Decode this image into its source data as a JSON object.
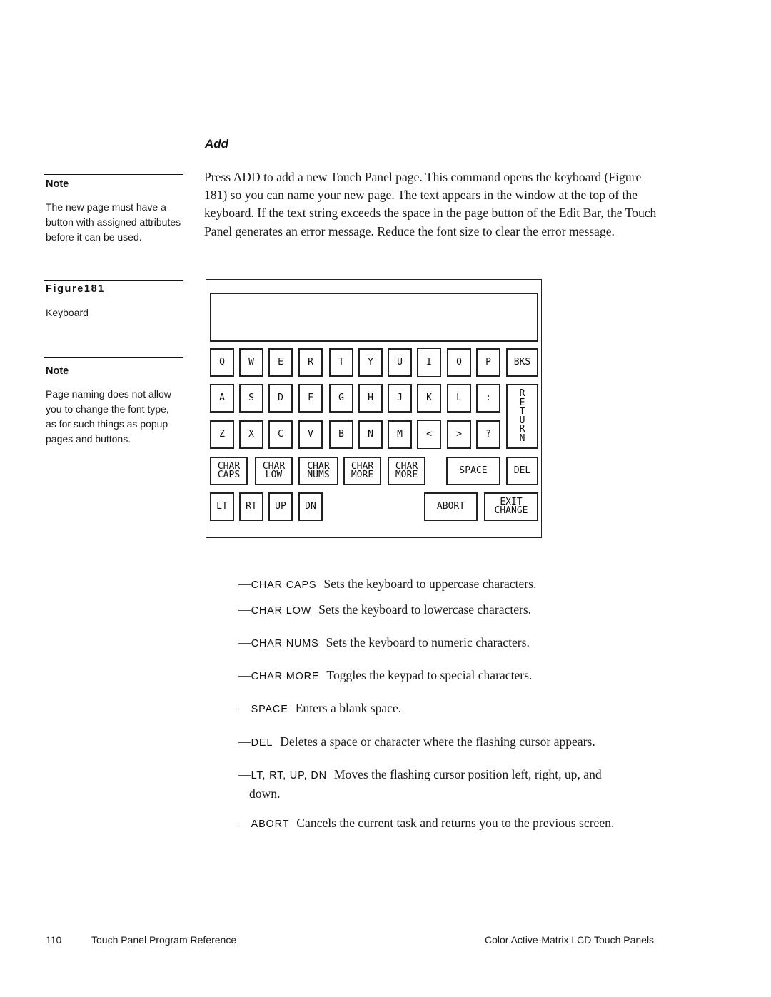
{
  "sidebar": {
    "note1": {
      "heading": "Note",
      "text": "The new page must have a button with assigned attributes before it can be used."
    },
    "figure": {
      "label": "Figure181",
      "caption": "Keyboard"
    },
    "note2": {
      "heading": "Note",
      "text": "Page naming does not allow you to change the font type, as for such things as popup pages and buttons."
    }
  },
  "main": {
    "section_title": "Add",
    "paragraph": "Press ADD to add a new Touch Panel page. This command opens the keyboard (Figure 181) so you can name your new page. The text appears in the window at the top of the keyboard. If the text string exceeds the space in the page button of the Edit Bar, the Touch Panel generates an error message. Reduce the font size to clear the error message."
  },
  "keyboard": {
    "display_text": "",
    "row1": [
      "Q",
      "W",
      "E",
      "R",
      "T",
      "Y",
      "U",
      "I",
      "O",
      "P",
      "BKS"
    ],
    "row2": [
      "A",
      "S",
      "D",
      "F",
      "G",
      "H",
      "J",
      "K",
      "L",
      ":"
    ],
    "row3": [
      "Z",
      "X",
      "C",
      "V",
      "B",
      "N",
      "M",
      "<",
      ">",
      "?"
    ],
    "return_key": "R\nE\nT\nU\nR\nN",
    "row4": [
      "CHAR\nCAPS",
      "CHAR\nLOW",
      "CHAR\nNUMS",
      "CHAR\nMORE",
      "CHAR\nMORE",
      "SPACE",
      "DEL"
    ],
    "row5": [
      "LT",
      "RT",
      "UP",
      "DN",
      "ABORT",
      "EXIT\nCHANGE"
    ]
  },
  "descriptions": [
    {
      "dash": "—",
      "term": "CHAR CAPS",
      "text": "Sets the keyboard to uppercase characters."
    },
    {
      "dash": "—",
      "term": "CHAR LOW",
      "text": "Sets the keyboard to lowercase characters."
    },
    {
      "dash": "—",
      "term": "CHAR NUMS",
      "text": "Sets the keyboard to numeric characters."
    },
    {
      "dash": "—",
      "term": "CHAR MORE",
      "text": "Toggles the keypad to special characters."
    },
    {
      "dash": "—",
      "term": "SPACE",
      "text": "Enters a blank space."
    },
    {
      "dash": "—",
      "term": "DEL",
      "text": "Deletes a space or character where the flashing cursor appears."
    },
    {
      "dash": "—",
      "term": "LT, RT, UP, DN",
      "text": "Moves the flashing cursor position left, right, up, and",
      "cont": "down."
    },
    {
      "dash": "—",
      "term": "ABORT",
      "text": "Cancels the current task and returns you to the previous screen."
    }
  ],
  "footer": {
    "page_number": "110",
    "left_title": "Touch Panel Program Reference",
    "right_title": "Color Active-Matrix LCD Touch Panels"
  }
}
